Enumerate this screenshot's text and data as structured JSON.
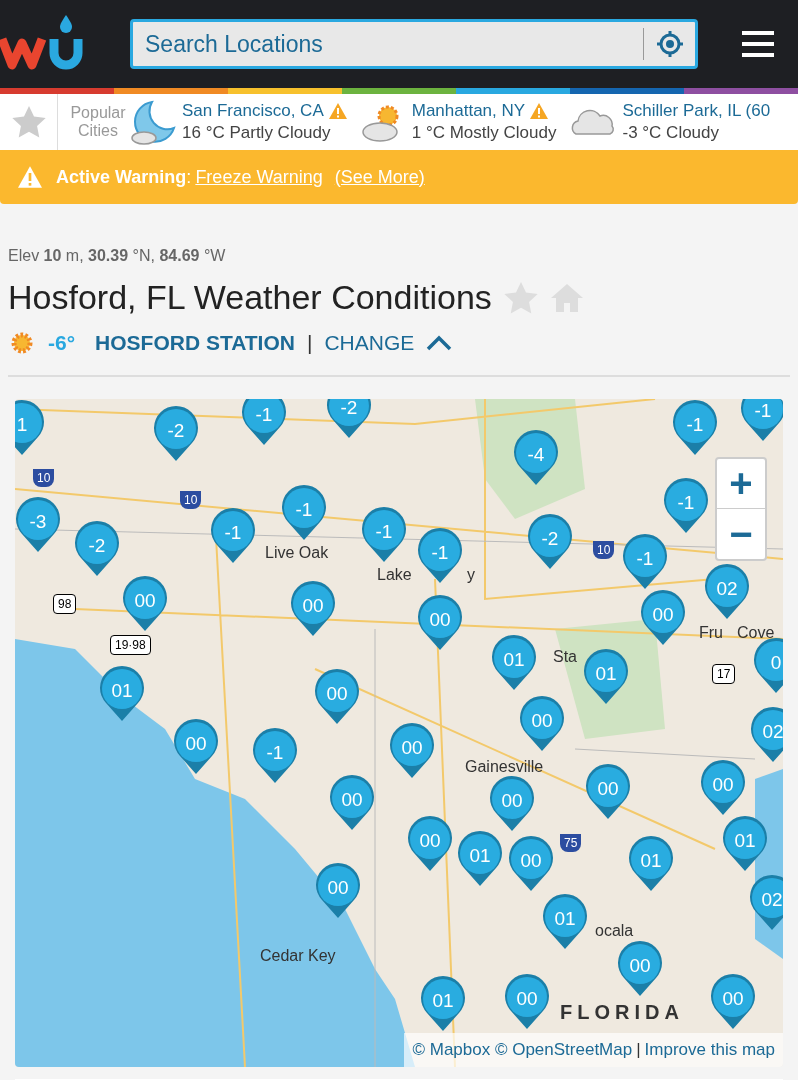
{
  "header": {
    "search": {
      "placeholder": "Search Locations"
    }
  },
  "popular": {
    "label": "Popular Cities",
    "cities": [
      {
        "name": "San Francisco, CA",
        "reading": "16 °C Partly Cloudy",
        "alert": true,
        "kind": "night-cloud"
      },
      {
        "name": "Manhattan, NY",
        "reading": "1 °C Mostly Cloudy",
        "alert": true,
        "kind": "sun-cloud"
      },
      {
        "name": "Schiller Park, IL (60",
        "reading": "-3 °C Cloudy",
        "alert": false,
        "kind": "cloud"
      }
    ]
  },
  "warning": {
    "label": "Active Warning",
    "separator": ":",
    "link": "Freeze Warning",
    "more": "(See More)"
  },
  "location": {
    "elev_prefix": "Elev",
    "elev": "10",
    "elev_unit": "m,",
    "lat": "30.39",
    "lat_unit": "°N,",
    "lon": "84.69",
    "lon_unit": "°W",
    "title": "Hosford, FL Weather Conditions",
    "temp": "-6°",
    "station": "HOSFORD STATION",
    "divider": "|",
    "change": "CHANGE"
  },
  "map": {
    "places": [
      "Live Oak",
      "Lake",
      "y",
      "Sta",
      "Fru",
      "Cove",
      "Gainesville",
      "Cedar Key",
      "ocala",
      "FLORIDA"
    ],
    "shields": [
      "10",
      "10",
      "10",
      "98",
      "19·98",
      "75",
      "17"
    ],
    "pins": [
      "1",
      "-2",
      "-1",
      "-2",
      "-1",
      "-1",
      "-4",
      "-3",
      "-1",
      "-1",
      "-1",
      "-1",
      "-2",
      "-1",
      "-1",
      "-2",
      "00",
      "02",
      "00",
      "00",
      "00",
      "0",
      "01",
      "01",
      "01",
      "00",
      "00",
      "02",
      "00",
      "-1",
      "00",
      "00",
      "00",
      "00",
      "00",
      "01",
      "00",
      "01",
      "00",
      "01",
      "02",
      "00",
      "01",
      "00",
      "01",
      "00",
      "00"
    ],
    "zoom_in": "+",
    "zoom_out": "−",
    "attribution": "© Mapbox © OpenStreetMap",
    "divider": "|",
    "improve": "Improve this map"
  }
}
